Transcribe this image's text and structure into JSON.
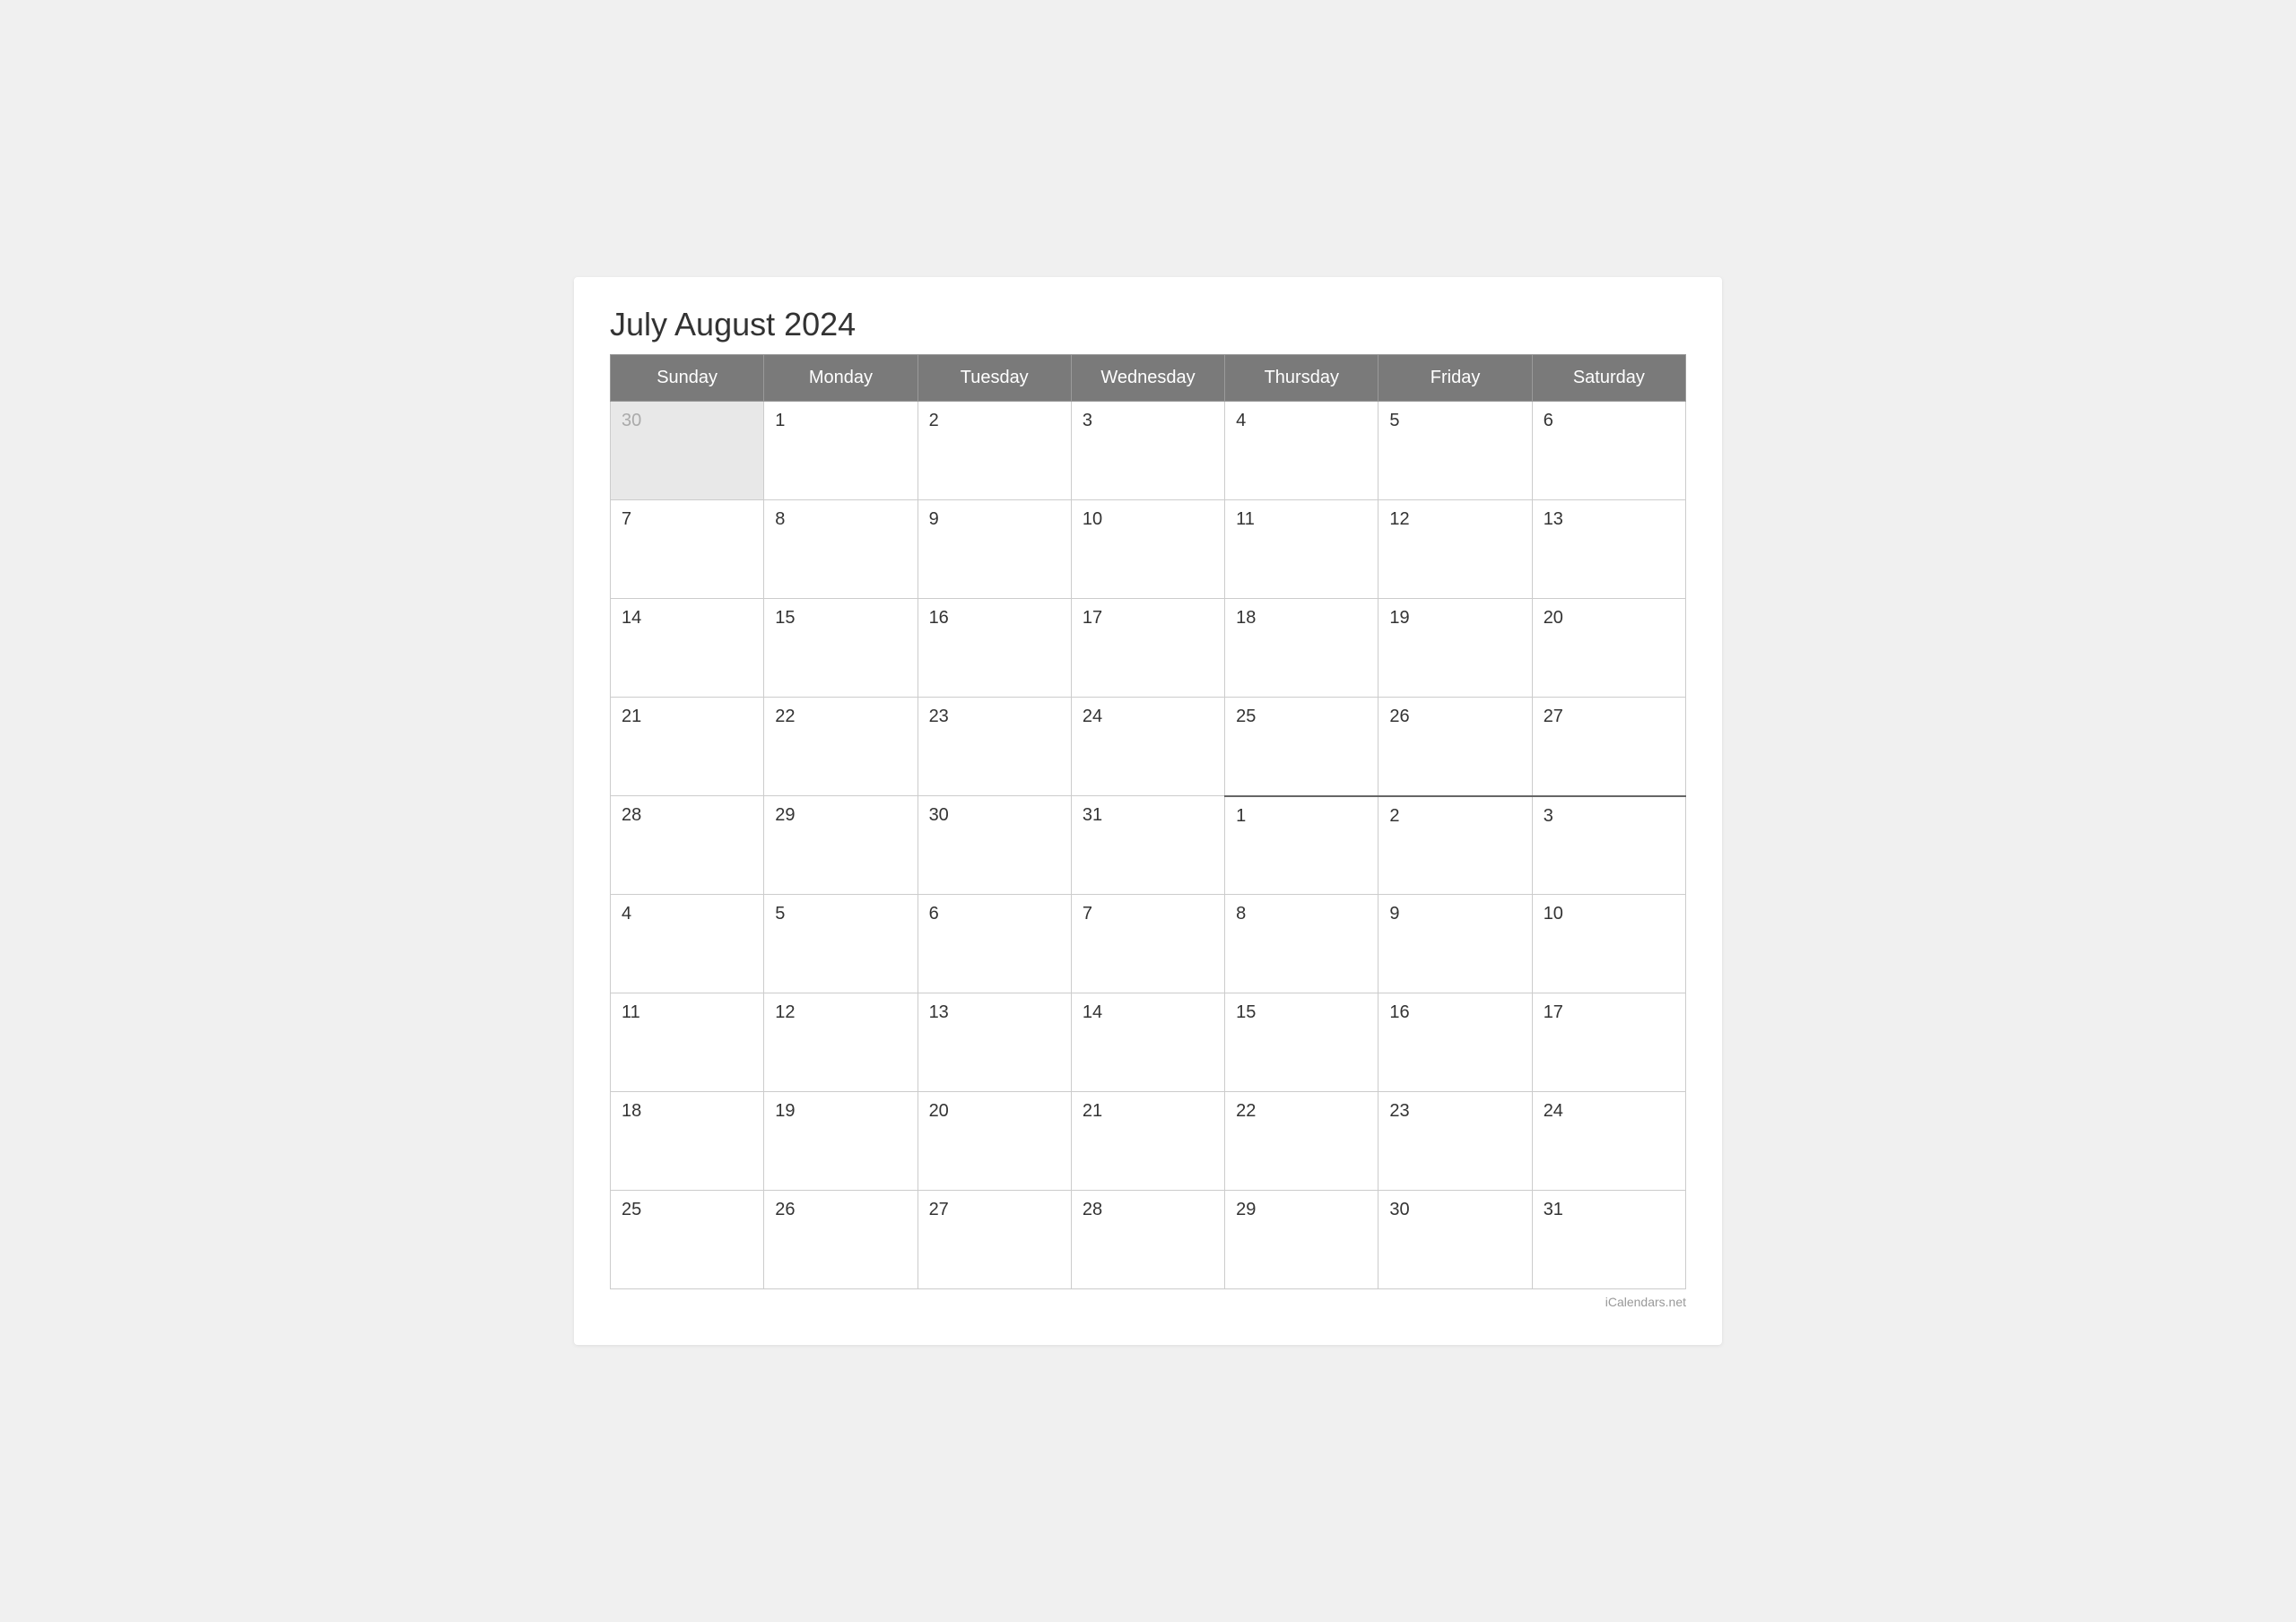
{
  "title": "July August 2024",
  "watermark": "iCalendars.net",
  "headers": [
    "Sunday",
    "Monday",
    "Tuesday",
    "Wednesday",
    "Thursday",
    "Friday",
    "Saturday"
  ],
  "weeks": [
    {
      "days": [
        {
          "label": "30",
          "type": "prev-month"
        },
        {
          "label": "1",
          "type": "current"
        },
        {
          "label": "2",
          "type": "current"
        },
        {
          "label": "3",
          "type": "current"
        },
        {
          "label": "4",
          "type": "current"
        },
        {
          "label": "5",
          "type": "current"
        },
        {
          "label": "6",
          "type": "current"
        }
      ]
    },
    {
      "days": [
        {
          "label": "7",
          "type": "current"
        },
        {
          "label": "8",
          "type": "current"
        },
        {
          "label": "9",
          "type": "current"
        },
        {
          "label": "10",
          "type": "current"
        },
        {
          "label": "11",
          "type": "current"
        },
        {
          "label": "12",
          "type": "current"
        },
        {
          "label": "13",
          "type": "current"
        }
      ]
    },
    {
      "days": [
        {
          "label": "14",
          "type": "current"
        },
        {
          "label": "15",
          "type": "current"
        },
        {
          "label": "16",
          "type": "current"
        },
        {
          "label": "17",
          "type": "current"
        },
        {
          "label": "18",
          "type": "current"
        },
        {
          "label": "19",
          "type": "current"
        },
        {
          "label": "20",
          "type": "current"
        }
      ]
    },
    {
      "days": [
        {
          "label": "21",
          "type": "current"
        },
        {
          "label": "22",
          "type": "current"
        },
        {
          "label": "23",
          "type": "current"
        },
        {
          "label": "24",
          "type": "current"
        },
        {
          "label": "25",
          "type": "current"
        },
        {
          "label": "26",
          "type": "current"
        },
        {
          "label": "27",
          "type": "current"
        }
      ]
    },
    {
      "days": [
        {
          "label": "28",
          "type": "current"
        },
        {
          "label": "29",
          "type": "current"
        },
        {
          "label": "30",
          "type": "current"
        },
        {
          "label": "31",
          "type": "current"
        },
        {
          "label": "1",
          "type": "next-month month-boundary"
        },
        {
          "label": "2",
          "type": "next-month month-boundary"
        },
        {
          "label": "3",
          "type": "next-month month-boundary"
        }
      ]
    },
    {
      "days": [
        {
          "label": "4",
          "type": "next-month"
        },
        {
          "label": "5",
          "type": "next-month"
        },
        {
          "label": "6",
          "type": "next-month"
        },
        {
          "label": "7",
          "type": "next-month"
        },
        {
          "label": "8",
          "type": "next-month"
        },
        {
          "label": "9",
          "type": "next-month"
        },
        {
          "label": "10",
          "type": "next-month"
        }
      ]
    },
    {
      "days": [
        {
          "label": "11",
          "type": "next-month"
        },
        {
          "label": "12",
          "type": "next-month"
        },
        {
          "label": "13",
          "type": "next-month"
        },
        {
          "label": "14",
          "type": "next-month"
        },
        {
          "label": "15",
          "type": "next-month"
        },
        {
          "label": "16",
          "type": "next-month"
        },
        {
          "label": "17",
          "type": "next-month"
        }
      ]
    },
    {
      "days": [
        {
          "label": "18",
          "type": "next-month"
        },
        {
          "label": "19",
          "type": "next-month"
        },
        {
          "label": "20",
          "type": "next-month"
        },
        {
          "label": "21",
          "type": "next-month"
        },
        {
          "label": "22",
          "type": "next-month"
        },
        {
          "label": "23",
          "type": "next-month"
        },
        {
          "label": "24",
          "type": "next-month"
        }
      ]
    },
    {
      "days": [
        {
          "label": "25",
          "type": "next-month"
        },
        {
          "label": "26",
          "type": "next-month"
        },
        {
          "label": "27",
          "type": "next-month"
        },
        {
          "label": "28",
          "type": "next-month"
        },
        {
          "label": "29",
          "type": "next-month"
        },
        {
          "label": "30",
          "type": "next-month"
        },
        {
          "label": "31",
          "type": "next-month"
        }
      ]
    }
  ]
}
